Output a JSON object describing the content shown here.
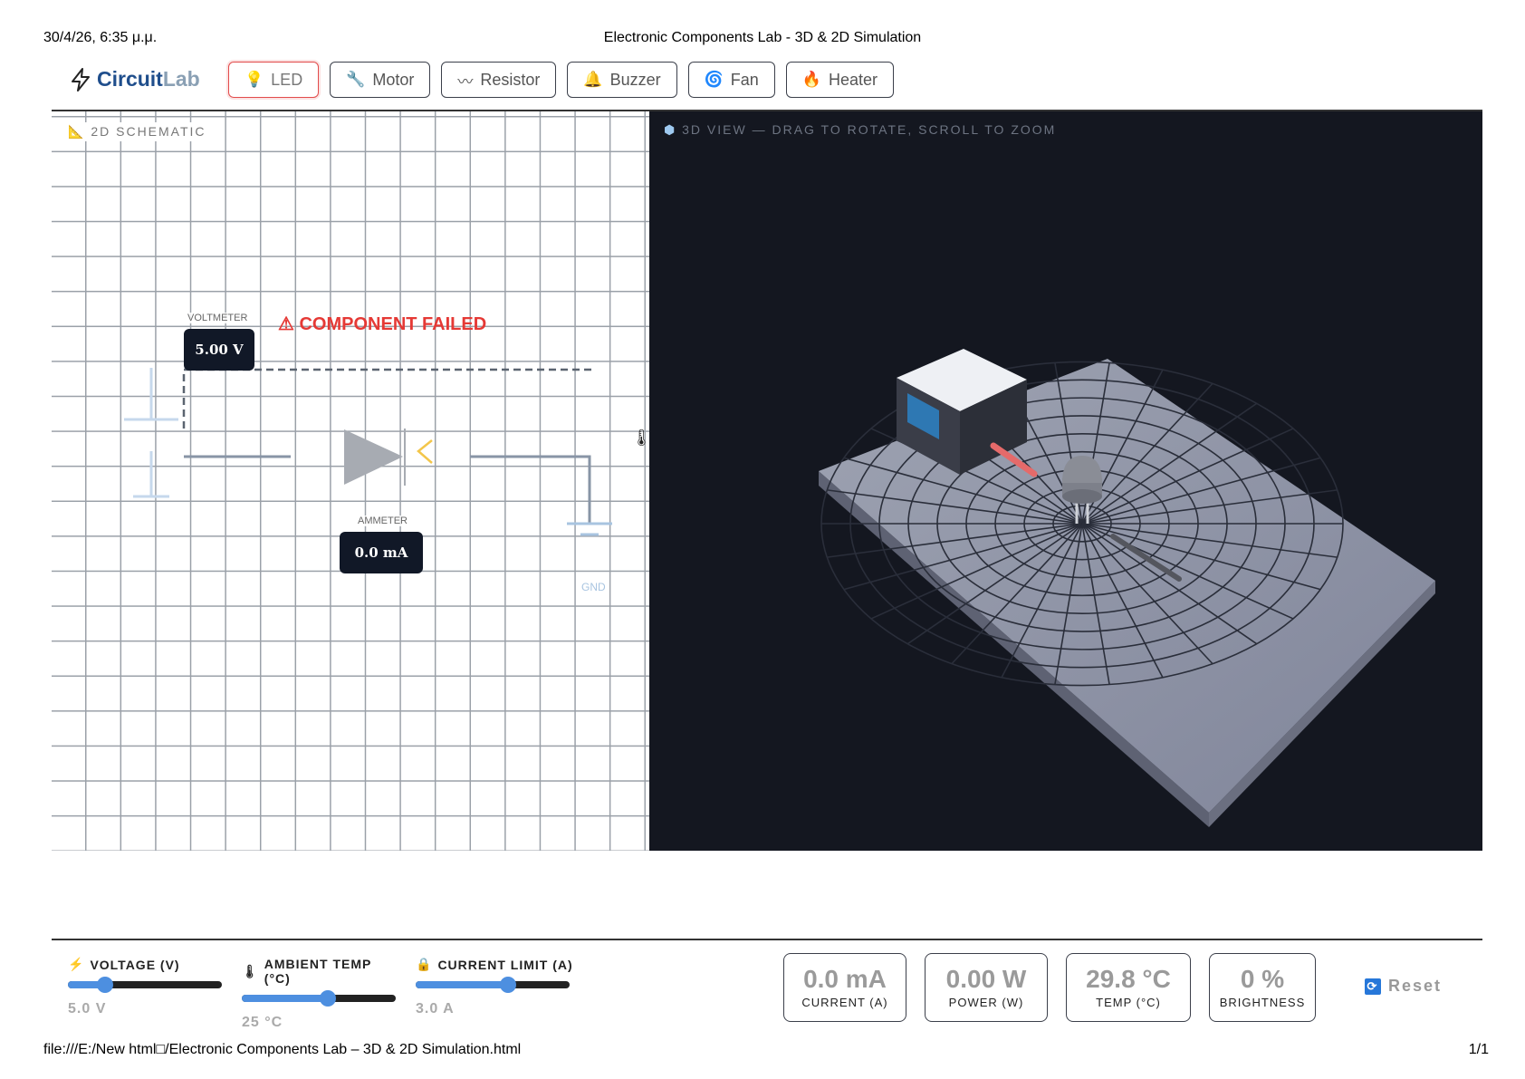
{
  "print": {
    "date": "30/4/26, 6:35 μ.μ.",
    "title": "Electronic Components Lab - 3D & 2D Simulation",
    "url": "file:///E:/New html□/Electronic Components Lab – 3D & 2D Simulation.html",
    "page": "1/1"
  },
  "logo": {
    "part1": "Circuit",
    "part2": "Lab",
    "icon": "lightning-icon"
  },
  "tabs": [
    {
      "label": "LED",
      "icon": "bulb-icon",
      "glyph": "💡",
      "active": true
    },
    {
      "label": "Motor",
      "icon": "wrench-icon",
      "glyph": "🔧",
      "active": false
    },
    {
      "label": "Resistor",
      "icon": "squiggle-icon",
      "glyph": "〰",
      "active": false
    },
    {
      "label": "Buzzer",
      "icon": "bell-icon",
      "glyph": "🔔",
      "active": false
    },
    {
      "label": "Fan",
      "icon": "fan-icon",
      "glyph": "🌀",
      "active": false
    },
    {
      "label": "Heater",
      "icon": "flame-icon",
      "glyph": "🔥",
      "active": false
    }
  ],
  "schematic": {
    "label": "2D SCHEMATIC",
    "status": "⚠ COMPONENT FAILED",
    "voltmeter": {
      "caption": "VOLTMETER",
      "value": "5.00 V"
    },
    "ammeter": {
      "caption": "AMMETER",
      "value": "0.0 mA"
    },
    "ground_label": "GND"
  },
  "view3d": {
    "label": "3D VIEW — DRAG TO ROTATE, SCROLL TO ZOOM"
  },
  "controls": [
    {
      "label": "VOLTAGE (V)",
      "icon": "lightning-icon",
      "glyph": "⚡",
      "value": "5.0 V",
      "fraction": 0.24
    },
    {
      "label": "AMBIENT TEMP (°C)",
      "icon": "thermometer-icon",
      "glyph": "🌡",
      "value": "25 °C",
      "fraction": 0.56
    },
    {
      "label": "CURRENT LIMIT (A)",
      "icon": "lock-icon",
      "glyph": "🔒",
      "value": "3.0 A",
      "fraction": 0.6
    }
  ],
  "stats": [
    {
      "value": "0.0 mA",
      "label": "CURRENT (A)"
    },
    {
      "value": "0.00 W",
      "label": "POWER (W)"
    },
    {
      "value": "29.8 °C",
      "label": "TEMP (°C)"
    },
    {
      "value": "0 %",
      "label": "BRIGHTNESS"
    }
  ],
  "reset": {
    "label": "Reset",
    "icon": "refresh-icon",
    "glyph": "🔄"
  },
  "colors": {
    "accent": "#4d8fe0",
    "fail": "#e53935",
    "dark_panel": "#141720",
    "brand": "#1f4e8c"
  }
}
